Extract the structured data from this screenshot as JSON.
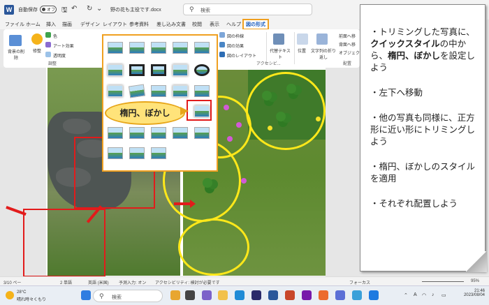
{
  "titlebar": {
    "autosave_label": "自動保存",
    "autosave_state": "オフ",
    "document_name": "野の花も主役です.docx",
    "search_placeholder": "検索"
  },
  "ribbon_tabs": [
    "ファイル",
    "ホーム",
    "挿入",
    "描画",
    "デザイン",
    "レイアウト",
    "参考資料",
    "差し込み文書",
    "校閲",
    "表示",
    "ヘルプ",
    "図の形式"
  ],
  "ribbon": {
    "remove_background": "背景の削除",
    "corrections": "修整",
    "color": "色",
    "artistic_effects": "アート効果",
    "transparency": "透明度",
    "adjust_group": "調整",
    "picture_border": "図の枠線",
    "picture_effects": "図の効果",
    "picture_layout": "図のレイアウト",
    "alt_text": "代替テキスト",
    "accessibility_group": "アクセシビ...",
    "position": "位置",
    "wrap_text": "文字列の折り返し",
    "bring_forward": "前面へ移",
    "send_backward": "背面へ移",
    "selection_pane": "オブジェク",
    "arrange_group": "配置"
  },
  "callout": {
    "label": "楕円、ぼかし"
  },
  "note": {
    "p1_a": "・トリミングした写真に、",
    "p1_b": "クイックスタイル",
    "p1_c": "の中から、",
    "p1_d": "楕円、ぼかし",
    "p1_e": "を設定しよう",
    "p2": "・左下へ移動",
    "p3": "・他の写真も同様に、正方形に近い形にトリミングしよう",
    "p4": "・楕円、ぼかしのスタイルを適用",
    "p5": "・それぞれ配置しよう"
  },
  "statusbar": {
    "page": "3/10 ペー",
    "words": "2 単語",
    "lang": "英語 (米国)",
    "predict": "予測入力: オン",
    "accessibility": "アクセシビリティ: 検討が必要です",
    "focus": "フォーカス",
    "zoom": "95%"
  },
  "taskbar": {
    "temperature": "28°C",
    "weather": "晴れ時々くもり",
    "search_placeholder": "検索",
    "ime": "A",
    "time": "21:46",
    "date": "2023/08/04"
  },
  "colors": {
    "accent_orange": "#f0a020",
    "word_blue": "#2b579a",
    "highlight_red": "#e21b1b",
    "circle_yellow": "#ffe81a"
  }
}
